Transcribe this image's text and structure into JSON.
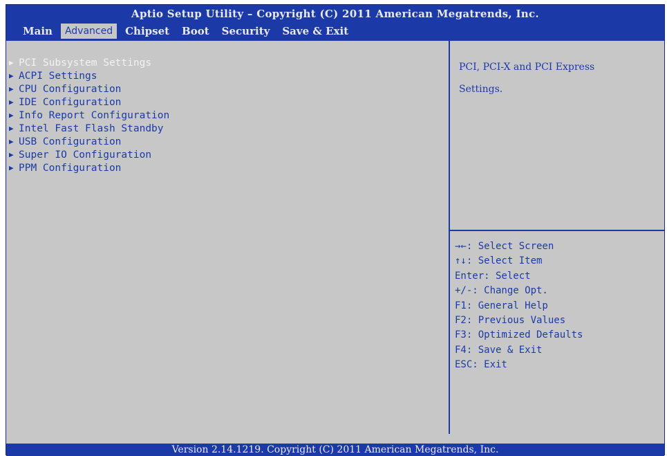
{
  "header": {
    "title": "Aptio Setup Utility – Copyright (C) 2011 American Megatrends, Inc.",
    "tabs": [
      {
        "label": "Main",
        "active": false
      },
      {
        "label": "Advanced",
        "active": true
      },
      {
        "label": "Chipset",
        "active": false
      },
      {
        "label": "Boot",
        "active": false
      },
      {
        "label": "Security",
        "active": false
      },
      {
        "label": "Save & Exit",
        "active": false
      }
    ]
  },
  "menu_items": [
    {
      "label": "PCI Subsystem Settings",
      "selected": true
    },
    {
      "label": "ACPI Settings",
      "selected": false
    },
    {
      "label": "CPU Configuration",
      "selected": false
    },
    {
      "label": "IDE Configuration",
      "selected": false
    },
    {
      "label": "Info Report Configuration",
      "selected": false
    },
    {
      "label": "Intel Fast Flash Standby",
      "selected": false
    },
    {
      "label": "USB Configuration",
      "selected": false
    },
    {
      "label": "Super IO Configuration",
      "selected": false
    },
    {
      "label": "PPM Configuration",
      "selected": false
    }
  ],
  "help": {
    "line1": "PCI, PCI-X and PCI Express",
    "line2": "Settings."
  },
  "keys": [
    "→←: Select Screen",
    "↑↓: Select Item",
    "Enter: Select",
    "+/-: Change Opt.",
    "F1: General Help",
    "F2: Previous Values",
    "F3: Optimized Defaults",
    "F4: Save & Exit",
    "ESC: Exit"
  ],
  "footer": {
    "version": "Version 2.14.1219. Copyright (C) 2011 American Megatrends, Inc."
  },
  "colors": {
    "accent_blue": "#1b3aa8",
    "panel_gray": "#c7c7c7",
    "highlight_text": "#f2f2f2"
  },
  "icons": {
    "submenu": "triangle-right"
  }
}
